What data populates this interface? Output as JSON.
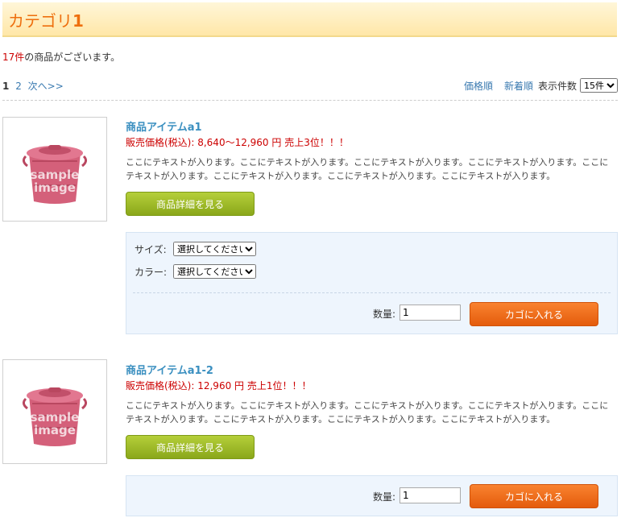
{
  "category": {
    "name": "カテゴリ",
    "number": "1"
  },
  "summary": {
    "count": "17件",
    "text": "の商品がございます。"
  },
  "pager": {
    "current": "1",
    "page2": "2",
    "next": "次へ>>"
  },
  "sort": {
    "price": "価格順",
    "newest": "新着順",
    "per_page_label": "表示件数",
    "per_page_value": "15件"
  },
  "thumbnail": {
    "watermark_line1": "sample",
    "watermark_line2": "image"
  },
  "products": [
    {
      "name": "商品アイテムa1",
      "price": "販売価格(税込): 8,640～12,960 円 売上3位！！！",
      "description": "ここにテキストが入ります。ここにテキストが入ります。ここにテキストが入ります。ここにテキストが入ります。ここにテキストが入ります。ここにテキストが入ります。ここにテキストが入ります。ここにテキストが入ります。",
      "detail_button": "商品詳細を見る",
      "size_label": "サイズ:",
      "size_value": "選択してください",
      "color_label": "カラー:",
      "color_value": "選択してください",
      "qty_label": "数量:",
      "qty_value": "1",
      "cart_button": "カゴに入れる"
    },
    {
      "name": "商品アイテムa1-2",
      "price": "販売価格(税込): 12,960 円 売上1位！！！",
      "description": "ここにテキストが入ります。ここにテキストが入ります。ここにテキストが入ります。ここにテキストが入ります。ここにテキストが入ります。ここにテキストが入ります。ここにテキストが入ります。ここにテキストが入ります。",
      "detail_button": "商品詳細を見る",
      "qty_label": "数量:",
      "qty_value": "1",
      "cart_button": "カゴに入れる"
    }
  ],
  "colors": {
    "accent_orange": "#ee6f0e",
    "link_blue": "#3a8fc0",
    "price_red": "#cc0000",
    "cart_orange": "#ef6f1c",
    "detail_green": "#9dbb26"
  }
}
